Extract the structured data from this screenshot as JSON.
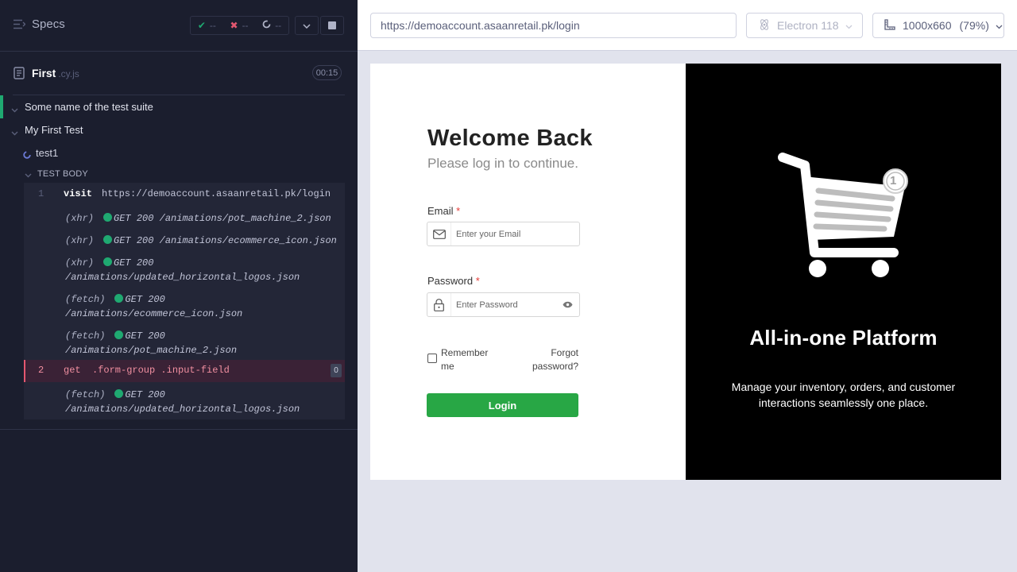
{
  "reporter": {
    "specs_label": "Specs",
    "stats": {
      "passed": "--",
      "failed": "--",
      "pending": "--"
    },
    "spec": {
      "name": "First",
      "ext": ".cy.js",
      "duration": "00:15"
    },
    "suites": [
      {
        "label": "Some name of the test suite"
      },
      {
        "label": "My First Test"
      }
    ],
    "test": {
      "label": "test1"
    },
    "body_label": "TEST BODY",
    "commands": [
      {
        "num": "1",
        "name": "visit",
        "message": "https://demoaccount.asaanretail.pk/login"
      },
      {
        "kind": "(xhr)",
        "method": "GET 200",
        "path": "/animations/pot_machine_2.json"
      },
      {
        "kind": "(xhr)",
        "method": "GET 200",
        "path": "/animations/ecommerce_icon.json"
      },
      {
        "kind": "(xhr)",
        "method": "GET 200",
        "path": "/animations/updated_horizontal_logos.json"
      },
      {
        "kind": "(fetch)",
        "method": "GET 200",
        "path": "/animations/ecommerce_icon.json"
      },
      {
        "kind": "(fetch)",
        "method": "GET 200",
        "path": "/animations/pot_machine_2.json"
      },
      {
        "num": "2",
        "name": "get",
        "message": ".form-group .input-field",
        "count": "0"
      },
      {
        "kind": "(fetch)",
        "method": "GET 200",
        "path": "/animations/updated_horizontal_logos.json"
      }
    ]
  },
  "aut": {
    "url": "https://demoaccount.asaanretail.pk/login",
    "browser": "Electron 118",
    "viewport": "1000x660",
    "zoom": "(79%)"
  },
  "login_page": {
    "title": "Welcome Back",
    "subtitle": "Please log in to continue.",
    "email_label": "Email",
    "email_placeholder": "Enter your Email",
    "password_label": "Password",
    "password_placeholder": "Enter Password",
    "required_mark": "*",
    "remember_label": "Remember me",
    "forgot_label": "Forgot password?",
    "login_button": "Login",
    "cart_badge": "1",
    "platform_title": "All-in-one Platform",
    "platform_desc": "Manage your inventory, orders, and customer interactions seamlessly one place."
  },
  "colors": {
    "accent_green": "#28a745",
    "pass_green": "#1fa971",
    "fail_red": "#e45770",
    "reporter_bg": "#1b1e2e"
  }
}
